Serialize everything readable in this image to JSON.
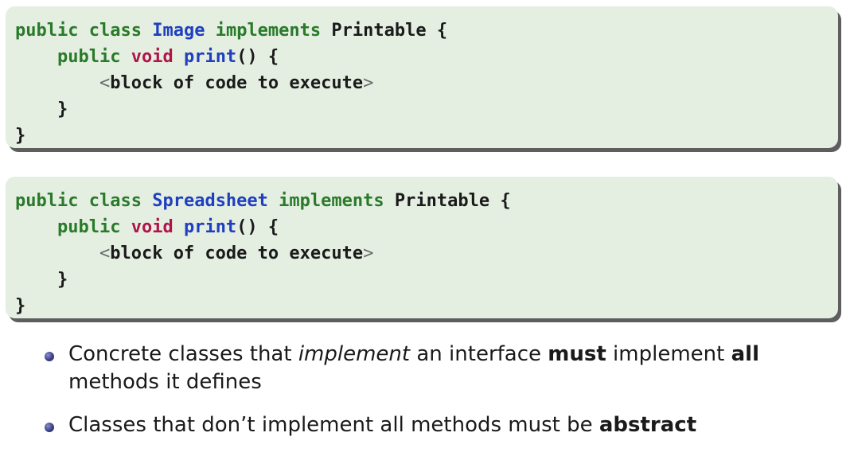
{
  "code_blocks": [
    {
      "public": "public",
      "class": "class",
      "class_name": "Image",
      "implements": "implements",
      "interface": "Printable",
      "open_brace": " {",
      "method_public": "public",
      "method_type": "void",
      "method_name": "print",
      "method_tail": "() {",
      "body_open": "<",
      "body_text": "block of code to execute",
      "body_close": ">",
      "inner_close": "}",
      "outer_close": "}"
    },
    {
      "public": "public",
      "class": "class",
      "class_name": "Spreadsheet",
      "implements": "implements",
      "interface": "Printable",
      "open_brace": " {",
      "method_public": "public",
      "method_type": "void",
      "method_name": "print",
      "method_tail": "() {",
      "body_open": "<",
      "body_text": "block of code to execute",
      "body_close": ">",
      "inner_close": "}",
      "outer_close": "}"
    }
  ],
  "bullets": [
    {
      "part1": "Concrete classes that ",
      "em": "implement",
      "part2": " an interface ",
      "strong1": "must",
      "part3": " implement ",
      "strong2": "all",
      "part4": " methods it defines"
    },
    {
      "part1": "Classes that don’t implement all methods must be ",
      "strong1": "abstract"
    }
  ],
  "colors": {
    "code_background": "#e4efe2",
    "keyword": "#2a7a2a",
    "type": "#b0154a",
    "identifier": "#1f3fbf",
    "bullet": "#3b3f8a"
  }
}
